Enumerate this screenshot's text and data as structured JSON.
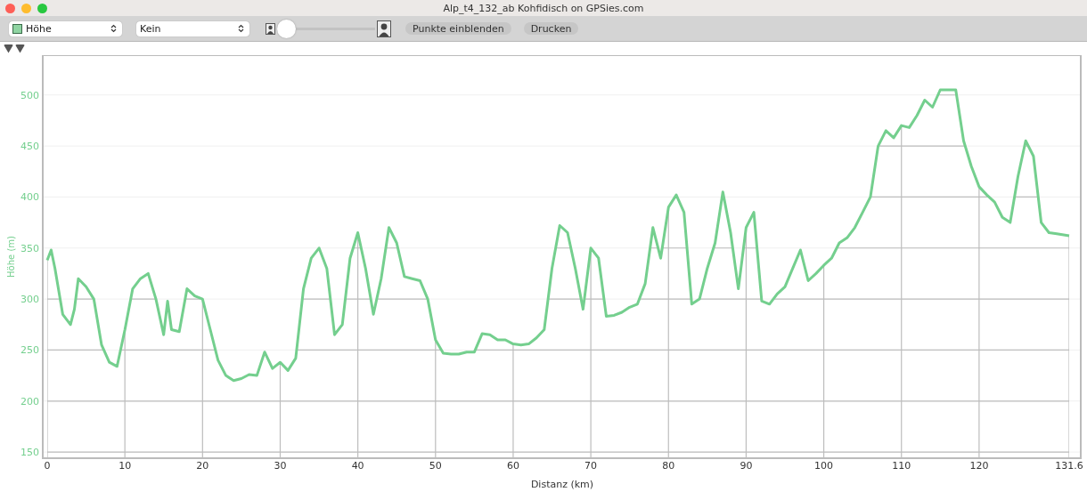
{
  "window": {
    "title": "Alp_t4_132_ab Kohfidisch on GPSies.com"
  },
  "toolbar": {
    "selects": [
      {
        "kind": "legend"
      },
      {
        "kind": "plain",
        "value": "Kein"
      }
    ],
    "slider": {
      "level": 0
    },
    "buttons": [
      "Punkte einblenden",
      "Drucken"
    ]
  },
  "markers": [
    {
      "kind": "pin"
    },
    {
      "kind": "pin"
    }
  ],
  "chart": {
    "chart_data": {
      "type": "line",
      "xlabel": "Distanz (km)",
      "ylabel": "Höhe (m)",
      "x": [
        0,
        0.5,
        1,
        2,
        3,
        3.5,
        4,
        5,
        6,
        7,
        8,
        9,
        10,
        11,
        12,
        13,
        14,
        15,
        15.5,
        16,
        17,
        18,
        19,
        20,
        21,
        22,
        23,
        24,
        25,
        26,
        27,
        28,
        29,
        30,
        31,
        32,
        33,
        34,
        35,
        36,
        37,
        38,
        39,
        40,
        41,
        42,
        43,
        44,
        45,
        46,
        47,
        48,
        49,
        50,
        51,
        52,
        53,
        54,
        55,
        56,
        57,
        58,
        59,
        60,
        61,
        62,
        63,
        64,
        65,
        66,
        67,
        68,
        69,
        70,
        71,
        72,
        73,
        74,
        75,
        76,
        77,
        78,
        79,
        80,
        81,
        82,
        83,
        84,
        85,
        86,
        87,
        88,
        89,
        90,
        91,
        92,
        93,
        94,
        95,
        96,
        97,
        98,
        99,
        100,
        101,
        102,
        103,
        104,
        105,
        106,
        107,
        108,
        109,
        110,
        111,
        112,
        113,
        114,
        115,
        116,
        117,
        118,
        119,
        120,
        121,
        122,
        123,
        124,
        125,
        126,
        127,
        128,
        129,
        130,
        131.6
      ],
      "series": [
        {
          "name": "Höhe",
          "color": "#74cf8e",
          "values": [
            338,
            348,
            330,
            285,
            275,
            290,
            320,
            312,
            300,
            255,
            238,
            234,
            270,
            310,
            320,
            325,
            300,
            265,
            298,
            270,
            268,
            310,
            303,
            300,
            270,
            240,
            225,
            220,
            222,
            226,
            225,
            248,
            232,
            238,
            230,
            242,
            310,
            340,
            350,
            330,
            265,
            275,
            340,
            365,
            330,
            285,
            320,
            370,
            355,
            322,
            320,
            318,
            300,
            260,
            247,
            246,
            246,
            248,
            248,
            266,
            265,
            260,
            260,
            256,
            255,
            256,
            262,
            270,
            330,
            372,
            365,
            330,
            290,
            350,
            340,
            283,
            284,
            287,
            292,
            295,
            315,
            370,
            340,
            390,
            402,
            385,
            295,
            300,
            330,
            355,
            405,
            365,
            310,
            370,
            385,
            298,
            295,
            305,
            312,
            330,
            348,
            318,
            325,
            333,
            340,
            355,
            360,
            370,
            385,
            400,
            450,
            465,
            458,
            470,
            468,
            480,
            495,
            488,
            505,
            505,
            505,
            455,
            430,
            410,
            402,
            395,
            380,
            375,
            420,
            455,
            440,
            375,
            365,
            364,
            362
          ]
        }
      ],
      "xlim": [
        0,
        131.6
      ],
      "ylim": [
        144,
        539
      ],
      "xticks": [
        0,
        10,
        20,
        30,
        40,
        50,
        60,
        70,
        80,
        90,
        100,
        110,
        120,
        {
          "value": 131.6,
          "label": "131.6"
        }
      ],
      "yticks": [
        150,
        200,
        250,
        300,
        350,
        400,
        450,
        500
      ],
      "grid": true
    }
  }
}
